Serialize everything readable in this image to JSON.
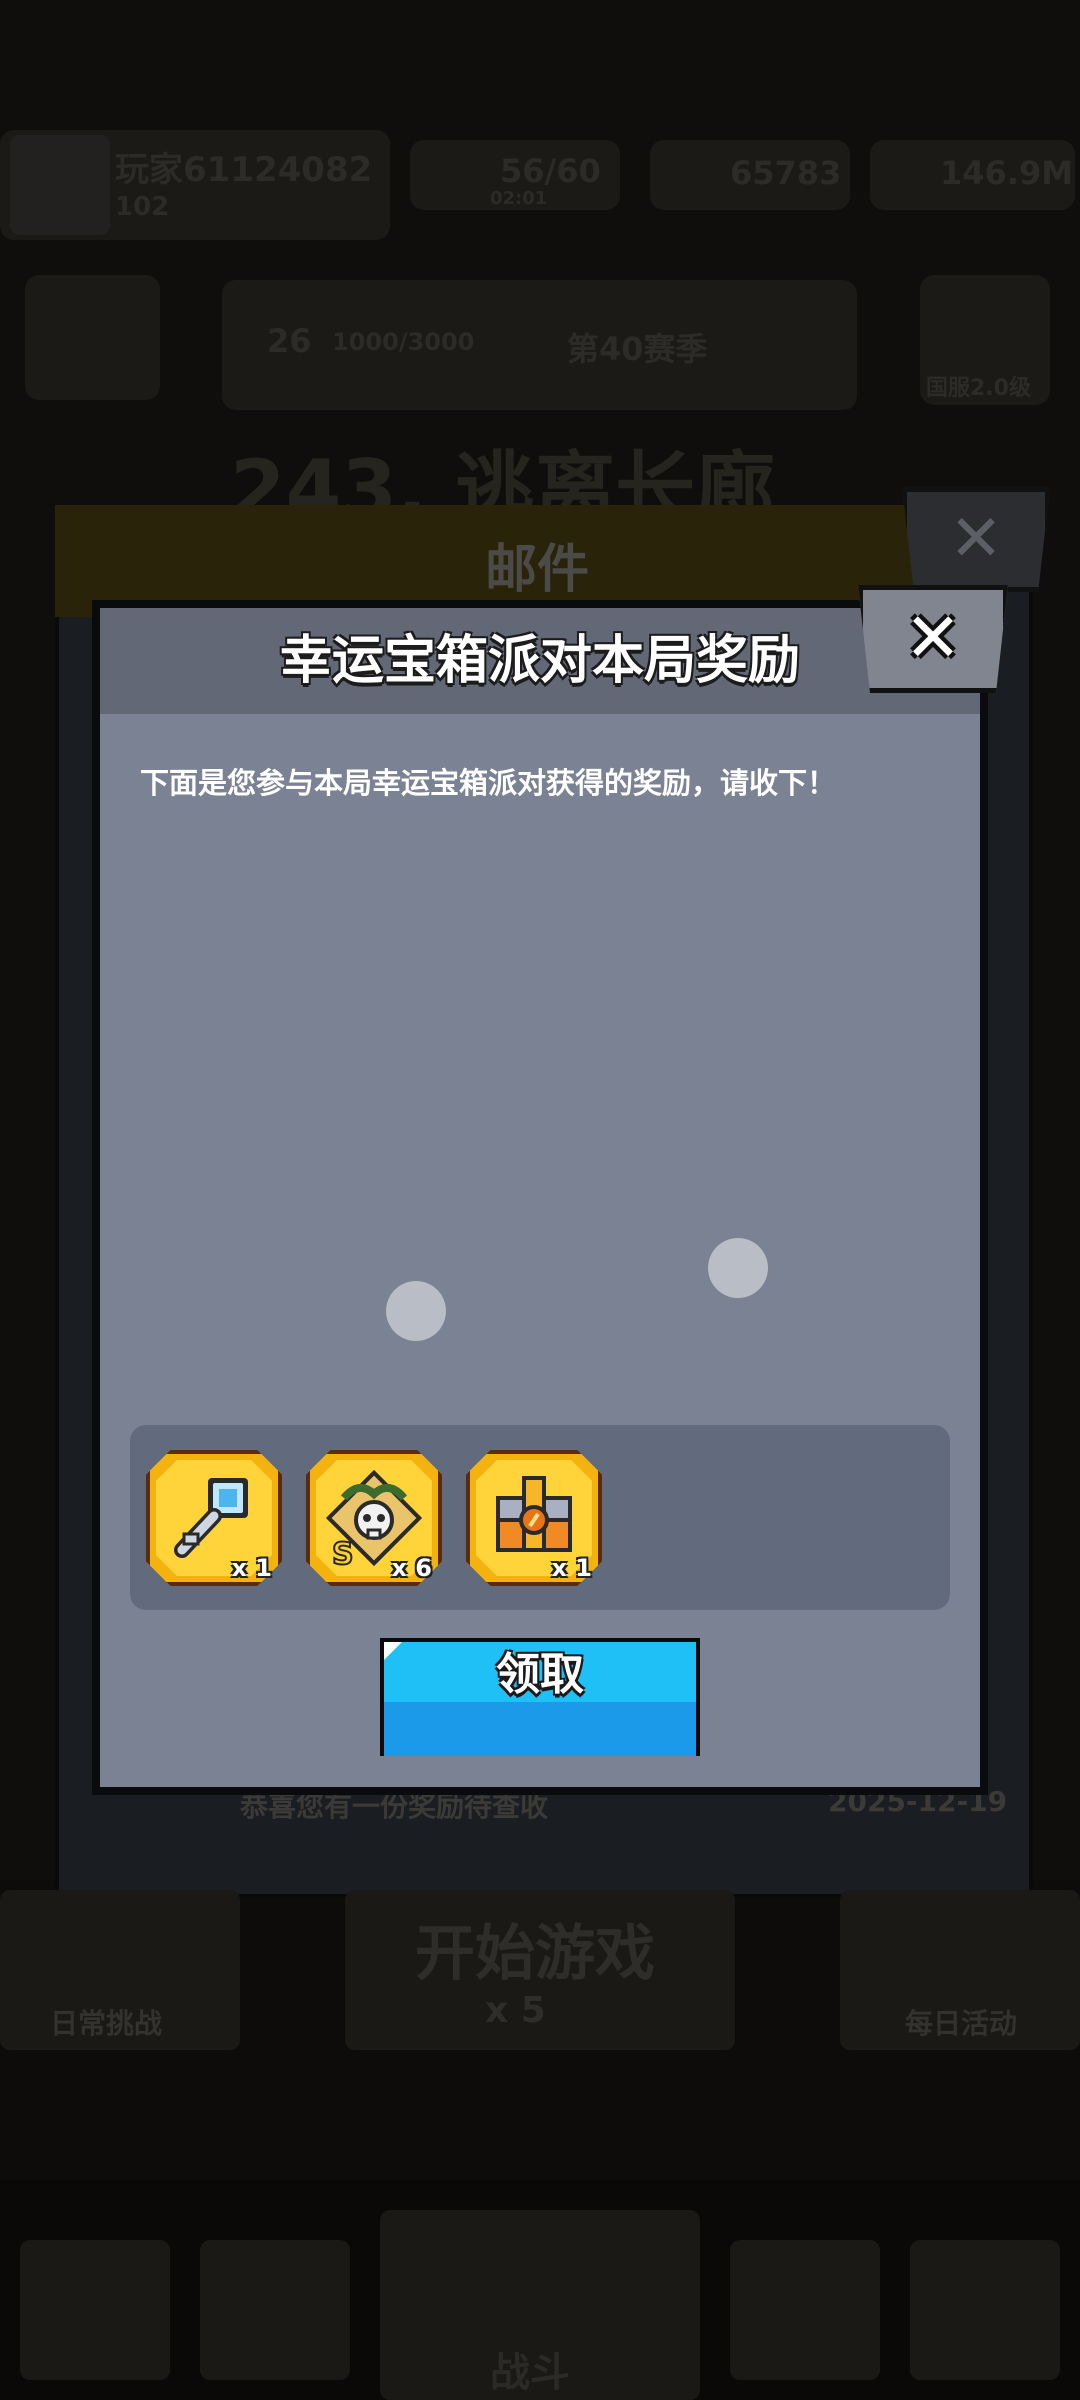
{
  "status_bar": {
    "player_name": "玩家61124082",
    "player_level": "102",
    "energy": "56/60",
    "energy_timer": "02:01",
    "gems": "65783",
    "coins": "146.9M"
  },
  "main": {
    "rank_number": "26",
    "rank_score": "1000/3000",
    "rank_title": "第40赛季",
    "badge_label": "国服2.0级",
    "level_title": "243. 逃离长廊",
    "start_button": "开始游戏",
    "start_cost": "x 5",
    "daily_task": "日常挑战",
    "daily_event": "每日活动",
    "battle_tab": "战斗"
  },
  "mail_panel": {
    "title": "邮件",
    "footer_text": "恭喜您有一份奖励待查收",
    "footer_date": "2025-12-19"
  },
  "dialog": {
    "title": "幸运宝箱派对本局奖励",
    "message": "下面是您参与本局幸运宝箱派对获得的奖励，请收下！",
    "claim_label": "领取",
    "close_glyph": "✕"
  },
  "rewards": [
    {
      "icon": "key-icon",
      "count": "x 1"
    },
    {
      "icon": "skull-scroll-icon",
      "count": "x 6"
    },
    {
      "icon": "treasure-chest-icon",
      "count": "x 1"
    }
  ],
  "colors": {
    "dialog_body": "#7b8294",
    "dialog_header": "#626875",
    "reward_frame": "#f3b20e",
    "claim_button": "#1ec0f6"
  }
}
